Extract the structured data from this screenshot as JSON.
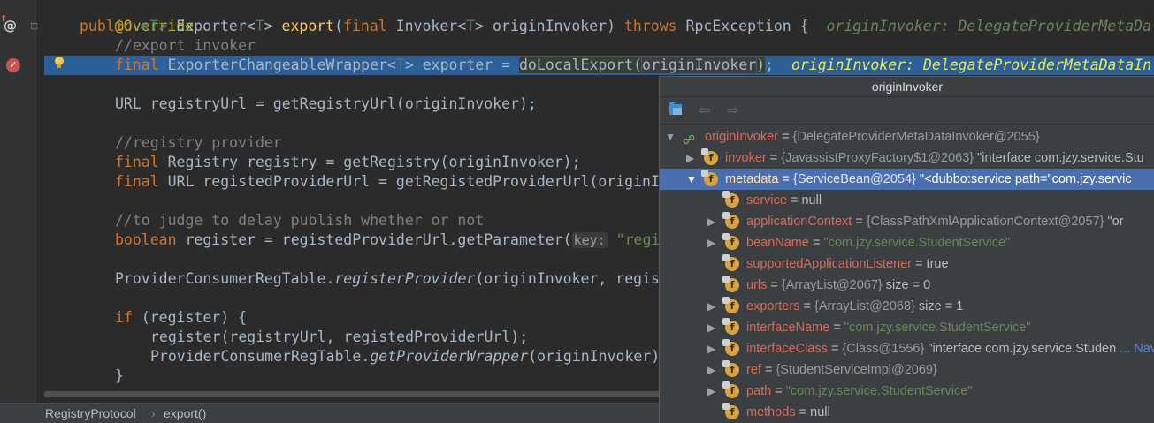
{
  "editor": {
    "lines": {
      "l0": {
        "ann": "@Override"
      },
      "l1": {
        "kw1": "public ",
        "gen1": "<T>",
        "sp1": " Exporter<",
        "gen2": "T",
        "sp2": "> ",
        "fn": "export",
        "p1": "(",
        "kw2": "final ",
        "t1": "Invoker<",
        "gen3": "T",
        "t2": "> originInvoker) ",
        "kw3": "throws ",
        "t3": "RpcException {",
        "hint": "originInvoker: DelegateProviderMetaDa"
      },
      "l2": {
        "cmt": "//export invoker"
      },
      "l3": {
        "kw1": "final ",
        "t1": "ExporterChangeableWrapper<",
        "gen1": "T",
        "t2": "> exporter = ",
        "box": "doLocalExport(",
        "box2": "originInvoker",
        "t3": ")",
        "t4": ";",
        "hint": "originInvoker: DelegateProviderMetaDataIn"
      },
      "l5": {
        "t1": "URL registryUrl = getRegistryUrl(originInvoker);"
      },
      "l7": {
        "cmt": "//registry provider"
      },
      "l8": {
        "kw1": "final ",
        "t1": "Registry registry = getRegistry(originInvoker);"
      },
      "l9": {
        "kw1": "final ",
        "t1": "URL registedProviderUrl = getRegistedProviderUrl(originI"
      },
      "l11": {
        "cmt": "//to judge to delay publish whether or not"
      },
      "l12": {
        "kw1": "boolean ",
        "t1": "register = registedProviderUrl.getParameter(",
        "param": "key:",
        "str": " \"regi"
      },
      "l14": {
        "t1": "ProviderConsumerRegTable.",
        "it": "registerProvider",
        "t2": "(originInvoker, regis"
      },
      "l16": {
        "kw1": "if ",
        "t1": "(register) {"
      },
      "l17": {
        "t1": "register(registryUrl, registedProviderUrl);"
      },
      "l18": {
        "t1": "ProviderConsumerRegTable.",
        "it": "getProviderWrapper",
        "t2": "(originInvoker)"
      },
      "l19": {
        "t1": "}"
      }
    }
  },
  "statusbar": {
    "crumb1": "RegistryProtocol",
    "sep": "›",
    "crumb2": "export()"
  },
  "popup": {
    "title": "originInvoker",
    "rows": [
      {
        "name": "originInvoker",
        "eq": " = ",
        "ref": "{DelegateProviderMetaDataInvoker@2055}",
        "rest": ""
      },
      {
        "name": "invoker",
        "eq": " = ",
        "ref": "{JavassistProxyFactory$1@2063}",
        "rest": " \"interface com.jzy.service.Stu"
      },
      {
        "name": "metadata",
        "eq": " = ",
        "ref": "{ServiceBean@2054}",
        "rest": " \"<dubbo:service path=\"com.jzy.servic"
      },
      {
        "name": "service",
        "eq": " = ",
        "ref": "",
        "rest": "null"
      },
      {
        "name": "applicationContext",
        "eq": " = ",
        "ref": "{ClassPathXmlApplicationContext@2057}",
        "rest": " \"or"
      },
      {
        "name": "beanName",
        "eq": " = ",
        "ref": "",
        "str": "\"com.jzy.service.StudentService\""
      },
      {
        "name": "supportedApplicationListener",
        "eq": " = ",
        "ref": "",
        "rest": "true"
      },
      {
        "name": "urls",
        "eq": " = ",
        "ref": "{ArrayList@2067}",
        "rest": "  size = 0"
      },
      {
        "name": "exporters",
        "eq": " = ",
        "ref": "{ArrayList@2068}",
        "rest": "  size = 1"
      },
      {
        "name": "interfaceName",
        "eq": " = ",
        "ref": "",
        "str": "\"com.jzy.service.StudentService\""
      },
      {
        "name": "interfaceClass",
        "eq": " = ",
        "ref": "{Class@1556}",
        "rest": " \"interface com.jzy.service.Studen",
        "link": "... Nav"
      },
      {
        "name": "ref",
        "eq": " = ",
        "ref": "{StudentServiceImpl@2069}",
        "rest": ""
      },
      {
        "name": "path",
        "eq": " = ",
        "ref": "",
        "str": "\"com.jzy.service.StudentService\""
      },
      {
        "name": "methods",
        "eq": " = ",
        "ref": "",
        "rest": "null"
      }
    ]
  }
}
